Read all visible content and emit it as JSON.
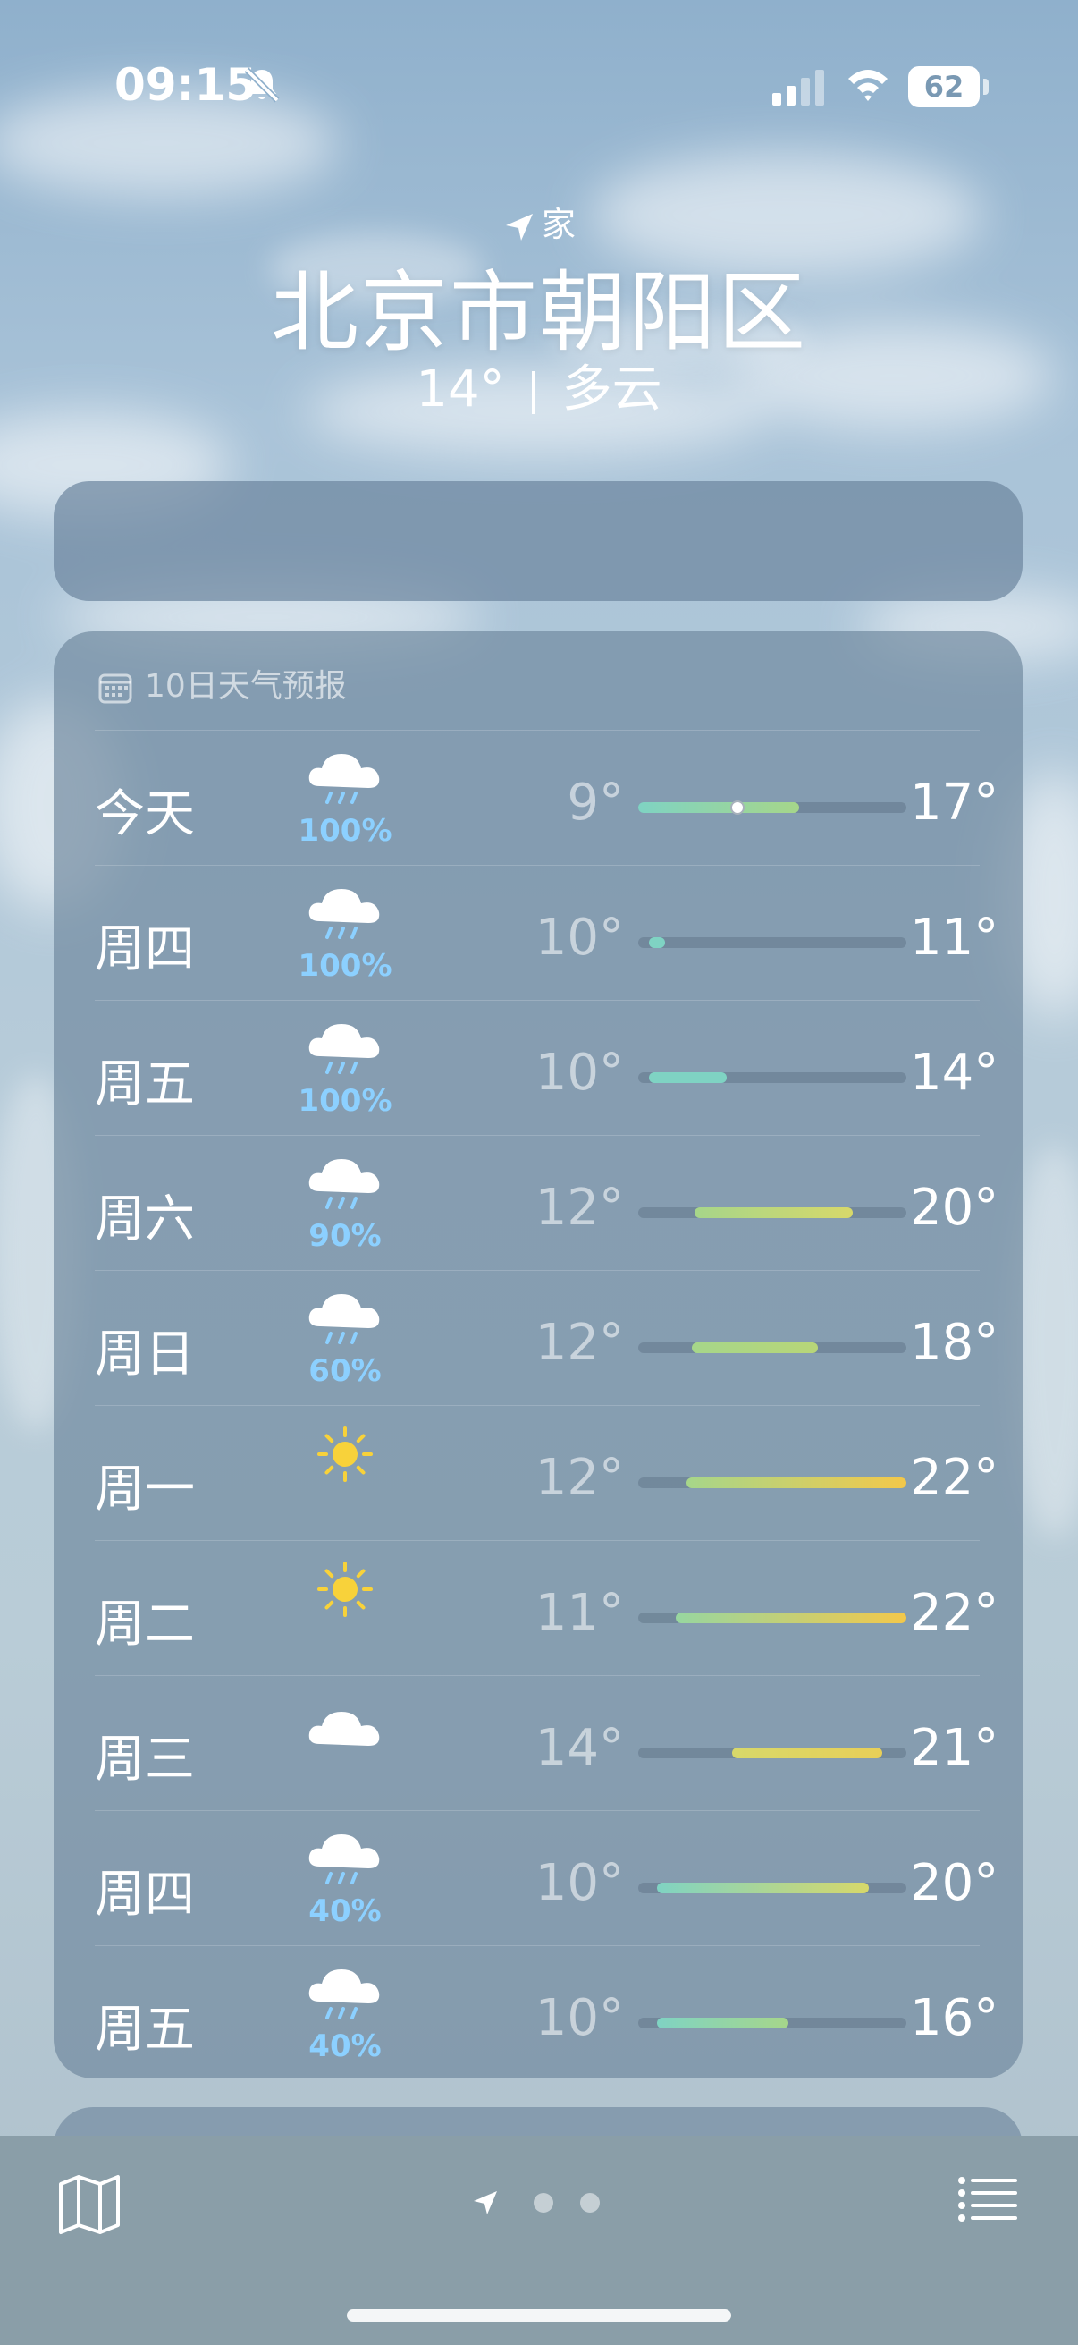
{
  "status_bar": {
    "time": "09:15",
    "battery": "62"
  },
  "location": {
    "label": "家",
    "city": "北京市朝阳区",
    "temperature": "14°",
    "condition": "多云"
  },
  "forecast": {
    "header": "10日天气预报",
    "days": [
      {
        "day": "今天",
        "icon": "rain-cloud-icon",
        "precip": "100%",
        "low": "9°",
        "high": "17°",
        "range": [
          0.0,
          0.6
        ],
        "current": 0.37,
        "colors": [
          "#7fd3c3",
          "#a6d68a"
        ]
      },
      {
        "day": "周四",
        "icon": "rain-cloud-icon",
        "precip": "100%",
        "low": "10°",
        "high": "11°",
        "range": [
          0.04,
          0.1
        ],
        "current": null,
        "colors": [
          "#7fd3c3",
          "#7fd3c3"
        ]
      },
      {
        "day": "周五",
        "icon": "rain-cloud-icon",
        "precip": "100%",
        "low": "10°",
        "high": "14°",
        "range": [
          0.04,
          0.33
        ],
        "current": null,
        "colors": [
          "#7fd3c3",
          "#7fd3c3"
        ]
      },
      {
        "day": "周六",
        "icon": "rain-cloud-icon",
        "precip": "90%",
        "low": "12°",
        "high": "20°",
        "range": [
          0.21,
          0.8
        ],
        "current": null,
        "colors": [
          "#a6d68a",
          "#d7d86a"
        ]
      },
      {
        "day": "周日",
        "icon": "rain-cloud-icon",
        "precip": "60%",
        "low": "12°",
        "high": "18°",
        "range": [
          0.2,
          0.67
        ],
        "current": null,
        "colors": [
          "#a6d68a",
          "#b8d678"
        ]
      },
      {
        "day": "周一",
        "icon": "sun-icon",
        "precip": "",
        "low": "12°",
        "high": "22°",
        "range": [
          0.18,
          1.0
        ],
        "current": null,
        "colors": [
          "#a6d68a",
          "#f3c84a"
        ]
      },
      {
        "day": "周二",
        "icon": "sun-icon",
        "precip": "",
        "low": "11°",
        "high": "22°",
        "range": [
          0.14,
          1.0
        ],
        "current": null,
        "colors": [
          "#97d6a0",
          "#f3c84a"
        ]
      },
      {
        "day": "周三",
        "icon": "cloud-icon",
        "precip": "",
        "low": "14°",
        "high": "21°",
        "range": [
          0.35,
          0.91
        ],
        "current": null,
        "colors": [
          "#d7d86a",
          "#e8cf58"
        ]
      },
      {
        "day": "周四",
        "icon": "rain-cloud-icon",
        "precip": "40%",
        "low": "10°",
        "high": "20°",
        "range": [
          0.07,
          0.86
        ],
        "current": null,
        "colors": [
          "#7fd3c3",
          "#d7d86a"
        ]
      },
      {
        "day": "周五",
        "icon": "rain-cloud-icon",
        "precip": "40%",
        "low": "10°",
        "high": "16°",
        "range": [
          0.07,
          0.56
        ],
        "current": null,
        "colors": [
          "#7fd3c3",
          "#a6d68a"
        ]
      }
    ]
  },
  "toolbar": {
    "map": "map-icon",
    "location": "location-arrow-icon",
    "list": "list-icon"
  }
}
